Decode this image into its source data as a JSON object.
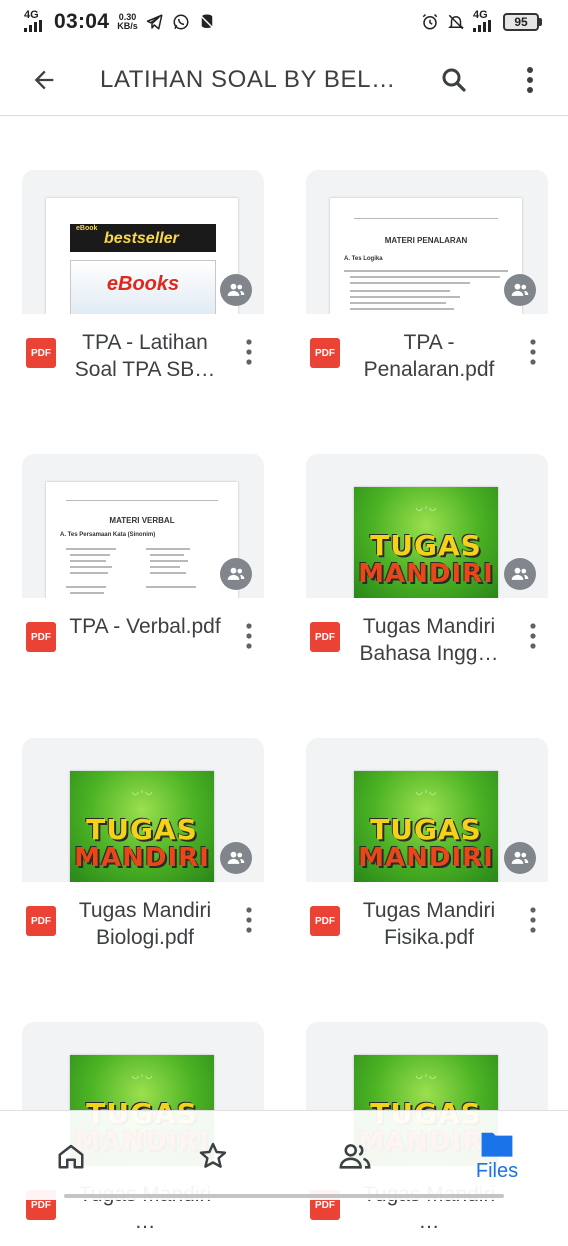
{
  "status_bar": {
    "network_left": "4G",
    "time": "03:04",
    "speed_value": "0.30",
    "speed_unit": "KB/s",
    "network_right": "4G",
    "battery": "95"
  },
  "app_bar": {
    "title": "LATIHAN SOAL BY BEL…"
  },
  "files": [
    {
      "name": "TPA - Latihan Soal TPA SB…",
      "thumb": "ebook",
      "type": "PDF"
    },
    {
      "name": "TPA - Penalaran.pdf",
      "thumb": "penalaran",
      "type": "PDF"
    },
    {
      "name": "TPA - Verbal.pdf",
      "thumb": "verbal",
      "type": "PDF"
    },
    {
      "name": "Tugas Mandiri Bahasa Ingg…",
      "thumb": "tugas",
      "type": "PDF"
    },
    {
      "name": "Tugas Mandiri Biologi.pdf",
      "thumb": "tugas",
      "type": "PDF"
    },
    {
      "name": "Tugas Mandiri Fisika.pdf",
      "thumb": "tugas",
      "type": "PDF"
    },
    {
      "name": "Tugas Mandiri …",
      "thumb": "tugas",
      "type": "PDF"
    },
    {
      "name": "Tugas Mandiri …",
      "thumb": "tugas",
      "type": "PDF"
    }
  ],
  "thumb_text": {
    "ebook_top1": "eBook",
    "ebook_top2": "bestseller",
    "ebook_main": "eBooks",
    "penalaran_head": "MATERI PENALARAN",
    "penalaran_sub": "A. Tes Logika",
    "verbal_head": "MATERI VERBAL",
    "verbal_sub": "A. Tes Persamaan Kata (Sinonim)",
    "tugas_line1": "TUGAS",
    "tugas_line2": "MANDIRI"
  },
  "bottom_nav": {
    "active_label": "Files",
    "items": [
      "home",
      "starred",
      "shared",
      "files"
    ]
  },
  "colors": {
    "accent": "#1a73e8",
    "pdf": "#ea4335",
    "shared_badge": "#80868b",
    "thumb_bg": "#f1f3f4"
  }
}
